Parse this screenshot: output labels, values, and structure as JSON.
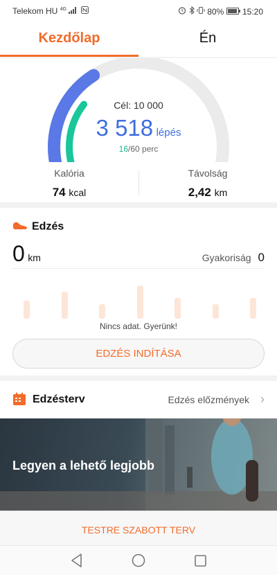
{
  "status_bar": {
    "carrier": "Telekom HU",
    "network": "4G",
    "battery": "80%",
    "time": "15:20"
  },
  "tabs": [
    {
      "label": "Kezdőlap",
      "active": true
    },
    {
      "label": "Én",
      "active": false
    }
  ],
  "daily": {
    "goal_label": "Cél: 10 000",
    "steps_value": "3 518",
    "steps_unit": "lépés",
    "steps": 3518,
    "goal": 10000,
    "active_minutes": "16",
    "minutes_total": "/60 perc",
    "minutes_fraction": 0.27,
    "calories_label": "Kalória",
    "calories_value": "74",
    "calories_unit": "kcal",
    "distance_label": "Távolság",
    "distance_value": "2,42",
    "distance_unit": "km"
  },
  "workout": {
    "title": "Edzés",
    "km_value": "0",
    "km_unit": "km",
    "frequency_label": "Gyakoriság",
    "frequency_value": "0",
    "no_data": "Nincs adat. Gyerünk!",
    "start_button": "EDZÉS INDÍTÁSA",
    "placeholder_bars": [
      0.52,
      0.78,
      0.42,
      0.96,
      0.6,
      0.42,
      0.6
    ]
  },
  "plan": {
    "title": "Edzésterv",
    "history_link": "Edzés előzmények"
  },
  "banner": {
    "text": "Legyen a lehető legjobb"
  },
  "custom_plan_button": "TESTRE SZABOTT TERV",
  "colors": {
    "accent": "#f26b2a",
    "steps_blue": "#3f6ee0",
    "minutes_green": "#19b98c",
    "bar_placeholder": "#fde6d8"
  },
  "nav": [
    "back-icon",
    "home-icon",
    "recents-icon"
  ]
}
